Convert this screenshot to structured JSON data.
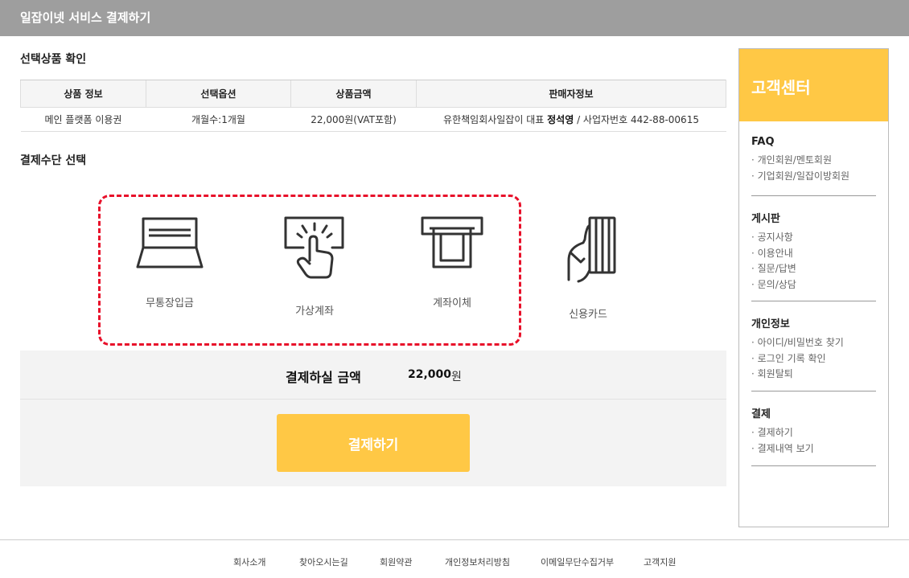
{
  "header": {
    "title": "일잡이넷 서비스 결제하기"
  },
  "selected_product": {
    "title": "선택상품 확인",
    "columns": [
      "상품 정보",
      "선택옵션",
      "상품금액",
      "판매자정보"
    ],
    "row": {
      "product": "메인 플랫폼 이용권",
      "option": "개월수:1개월",
      "price": "22,000원(VAT포함)",
      "seller_prefix": "유한책임회사일잡이 대표",
      "seller_name": "정석영",
      "seller_suffix": "/ 사업자번호 442-88-00615"
    }
  },
  "payment_method": {
    "title": "결제수단 선택",
    "options": [
      {
        "label": "무통장입금",
        "icon": "laptop-icon"
      },
      {
        "label": "가상계좌",
        "icon": "touch-screen-icon"
      },
      {
        "label": "계좌이체",
        "icon": "atm-transfer-icon"
      },
      {
        "label": "신용카드",
        "icon": "credit-card-icon"
      }
    ]
  },
  "payment": {
    "amount_label": "결제하실 금액",
    "amount_value": "22,000",
    "amount_unit": "원",
    "pay_button": "결제하기"
  },
  "customer_center": {
    "title": "고객센터",
    "groups": [
      {
        "title": "FAQ",
        "items": [
          "· 개인회원/멘토회원",
          "· 기업회원/일잡이방회원"
        ]
      },
      {
        "title": "게시판",
        "items": [
          "· 공지사항",
          "· 이용안내",
          "· 질문/답변",
          "· 문의/상담"
        ]
      },
      {
        "title": "개인정보",
        "items": [
          "· 아이디/비밀번호 찾기",
          "· 로그인 기록 확인",
          "· 회원탈퇴"
        ]
      },
      {
        "title": "결제",
        "items": [
          "· 결제하기",
          "· 결제내역 보기"
        ]
      }
    ]
  },
  "footer": {
    "links": [
      "회사소개",
      "찾아오시는길",
      "회원약관",
      "개인정보처리방침",
      "이메일무단수집거부",
      "고객지원"
    ]
  },
  "colors": {
    "accent": "#ffc845",
    "header_bg": "#9e9e9e",
    "highlight": "#e8102a"
  }
}
